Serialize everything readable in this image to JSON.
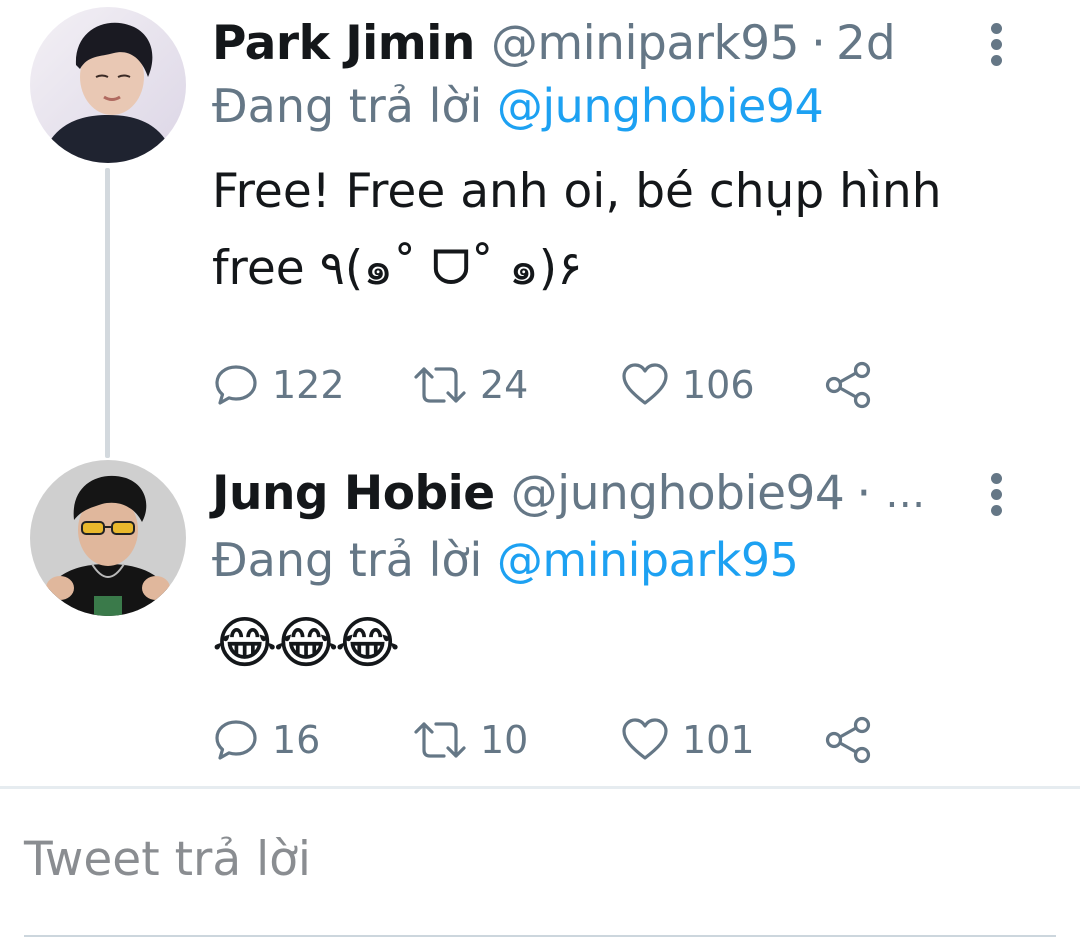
{
  "tweets": [
    {
      "author_name": "Park Jimin",
      "handle": "@minipark95",
      "separator": "·",
      "time": "2d",
      "replying_prefix": "Đang trả lời",
      "replying_to": "@junghobie94",
      "text": "Free! Free anh oi, bé chụp hình\nfree ٩(๑˚ ᗜ˚ ๑)۶",
      "replies": "122",
      "retweets": "24",
      "likes": "106"
    },
    {
      "author_name": "Jung Hobie",
      "handle": "@junghobie94",
      "separator": "·",
      "time_truncated": "…",
      "replying_prefix": "Đang trả lời",
      "replying_to": "@minipark95",
      "text": "😂😂😂",
      "replies": "16",
      "retweets": "10",
      "likes": "101"
    }
  ],
  "reply_box": {
    "placeholder": "Tweet trả lời"
  },
  "icons": {
    "reply": "speech-bubble-icon",
    "retweet": "retweet-icon",
    "like": "heart-icon",
    "share": "share-icon",
    "more": "vertical-dots-icon"
  },
  "colors": {
    "link": "#1da1f2",
    "secondary_text": "#657786",
    "primary_text": "#14171a",
    "thread_line": "#d3d9de",
    "divider": "#e6ecf0"
  }
}
